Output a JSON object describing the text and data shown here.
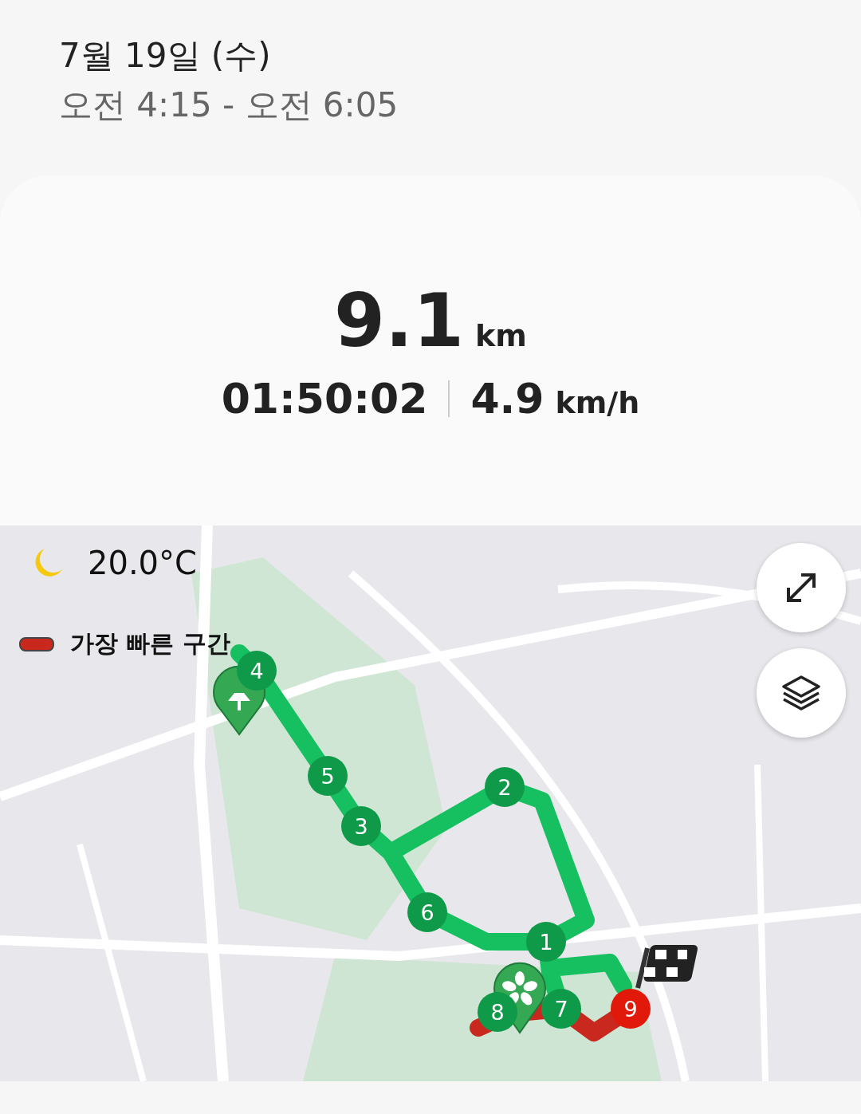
{
  "header": {
    "date": "7월 19일 (수)",
    "time_range": "오전 4:15 - 오전 6:05"
  },
  "summary": {
    "distance": "9.1",
    "distance_unit": "km",
    "duration": "01:50:02",
    "speed": "4.9",
    "speed_unit": "km/h"
  },
  "map": {
    "weather": {
      "temperature": "20.0°C"
    },
    "legend": {
      "label": "가장 빠른 구간",
      "color": "#c8281e"
    },
    "markers": [
      {
        "label": "1",
        "color": "#0f9a4a"
      },
      {
        "label": "2",
        "color": "#0f9a4a"
      },
      {
        "label": "3",
        "color": "#0f9a4a"
      },
      {
        "label": "4",
        "color": "#0f9a4a"
      },
      {
        "label": "5",
        "color": "#0f9a4a"
      },
      {
        "label": "6",
        "color": "#0f9a4a"
      },
      {
        "label": "8",
        "color": "#0f9a4a"
      },
      {
        "label": "7",
        "color": "#0f9a4a"
      },
      {
        "label": "9",
        "color": "#e0190b"
      }
    ]
  }
}
